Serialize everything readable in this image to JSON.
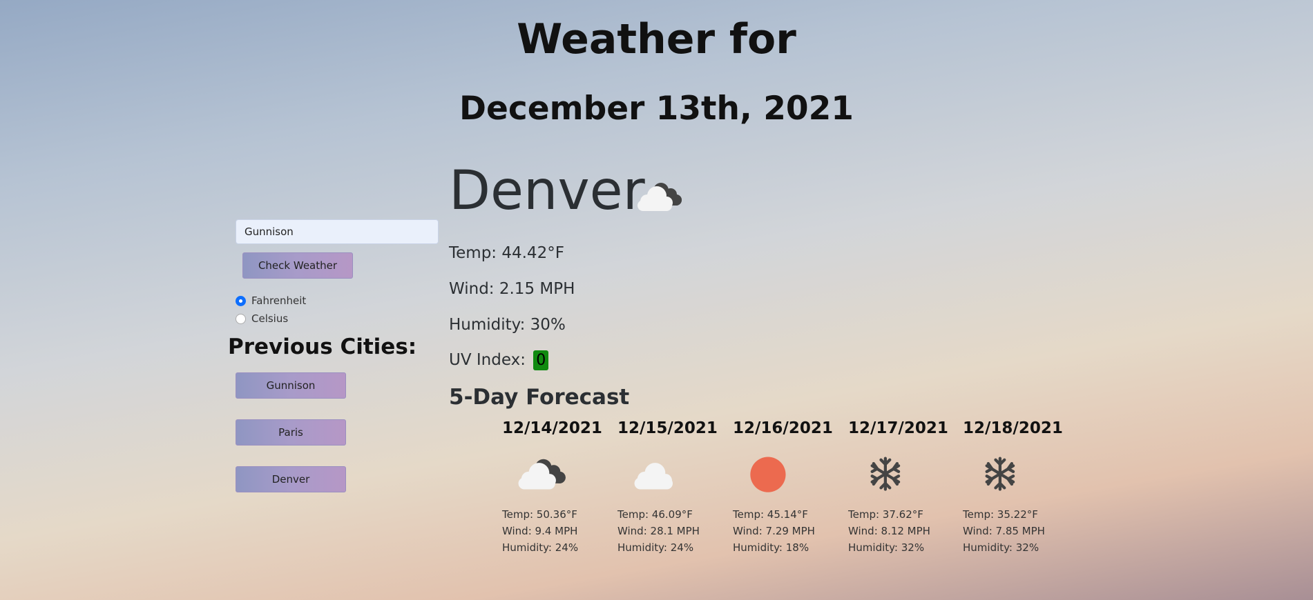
{
  "header": {
    "title": "Weather for",
    "date": "December 13th, 2021"
  },
  "sidebar": {
    "search_value": "Gunnison",
    "check_label": "Check Weather",
    "units": [
      {
        "label": "Fahrenheit",
        "selected": true
      },
      {
        "label": "Celsius",
        "selected": false
      }
    ],
    "previous_title": "Previous Cities:",
    "previous_cities": [
      "Gunnison",
      "Paris",
      "Denver"
    ]
  },
  "current": {
    "city": "Denver",
    "icon": "partly-cloudy-icon",
    "temp": "Temp: 44.42°F",
    "wind": "Wind: 2.15 MPH",
    "humidity": "Humidity: 30%",
    "uv_label": "UV Index:",
    "uv_value": "0",
    "uv_color": "#108a10"
  },
  "forecast": {
    "title": "5-Day Forecast",
    "days": [
      {
        "date": "12/14/2021",
        "icon": "partly-cloudy-icon",
        "temp": "Temp: 50.36°F",
        "wind": "Wind: 9.4 MPH",
        "humidity": "Humidity: 24%"
      },
      {
        "date": "12/15/2021",
        "icon": "cloud-icon",
        "temp": "Temp: 46.09°F",
        "wind": "Wind: 28.1 MPH",
        "humidity": "Humidity: 24%"
      },
      {
        "date": "12/16/2021",
        "icon": "sun-icon",
        "temp": "Temp: 45.14°F",
        "wind": "Wind: 7.29 MPH",
        "humidity": "Humidity: 18%"
      },
      {
        "date": "12/17/2021",
        "icon": "snowflake-icon",
        "temp": "Temp: 37.62°F",
        "wind": "Wind: 8.12 MPH",
        "humidity": "Humidity: 32%"
      },
      {
        "date": "12/18/2021",
        "icon": "snowflake-icon",
        "temp": "Temp: 35.22°F",
        "wind": "Wind: 7.85 MPH",
        "humidity": "Humidity: 32%"
      }
    ]
  },
  "colors": {
    "sun": "#ec6a4f",
    "cloud_light": "#f4f4f4",
    "cloud_dark": "#444444",
    "button": "#a89bc9"
  }
}
